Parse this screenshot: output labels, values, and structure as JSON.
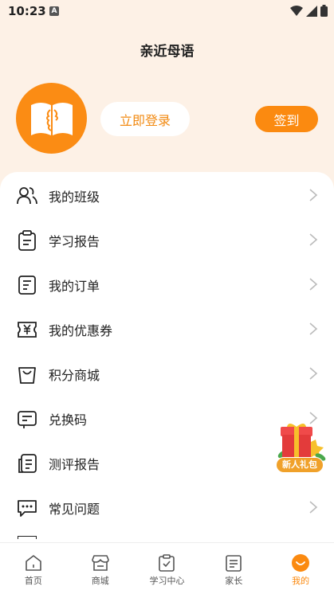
{
  "status_bar": {
    "time": "10:23",
    "notification_icon": "A"
  },
  "header": {
    "title": "亲近母语"
  },
  "profile": {
    "avatar_icon": "book-icon",
    "login_label": "立即登录",
    "sign_in_label": "签到"
  },
  "menu": {
    "items": [
      {
        "label": "我的班级",
        "icon": "class-icon"
      },
      {
        "label": "学习报告",
        "icon": "clipboard-icon"
      },
      {
        "label": "我的订单",
        "icon": "order-icon"
      },
      {
        "label": "我的优惠券",
        "icon": "coupon-icon"
      },
      {
        "label": "积分商城",
        "icon": "bag-icon"
      },
      {
        "label": "兑换码",
        "icon": "code-icon"
      },
      {
        "label": "测评报告",
        "icon": "report-icon"
      },
      {
        "label": "常见问题",
        "icon": "faq-icon"
      }
    ]
  },
  "gift": {
    "label": "新人礼包"
  },
  "tabs": [
    {
      "label": "首页",
      "icon": "home-icon",
      "active": false
    },
    {
      "label": "商城",
      "icon": "store-icon",
      "active": false
    },
    {
      "label": "学习中心",
      "icon": "study-icon",
      "active": false
    },
    {
      "label": "家长",
      "icon": "parent-icon",
      "active": false
    },
    {
      "label": "我的",
      "icon": "me-icon",
      "active": true
    }
  ],
  "colors": {
    "accent": "#fb8a10",
    "background": "#fdf1e6"
  }
}
